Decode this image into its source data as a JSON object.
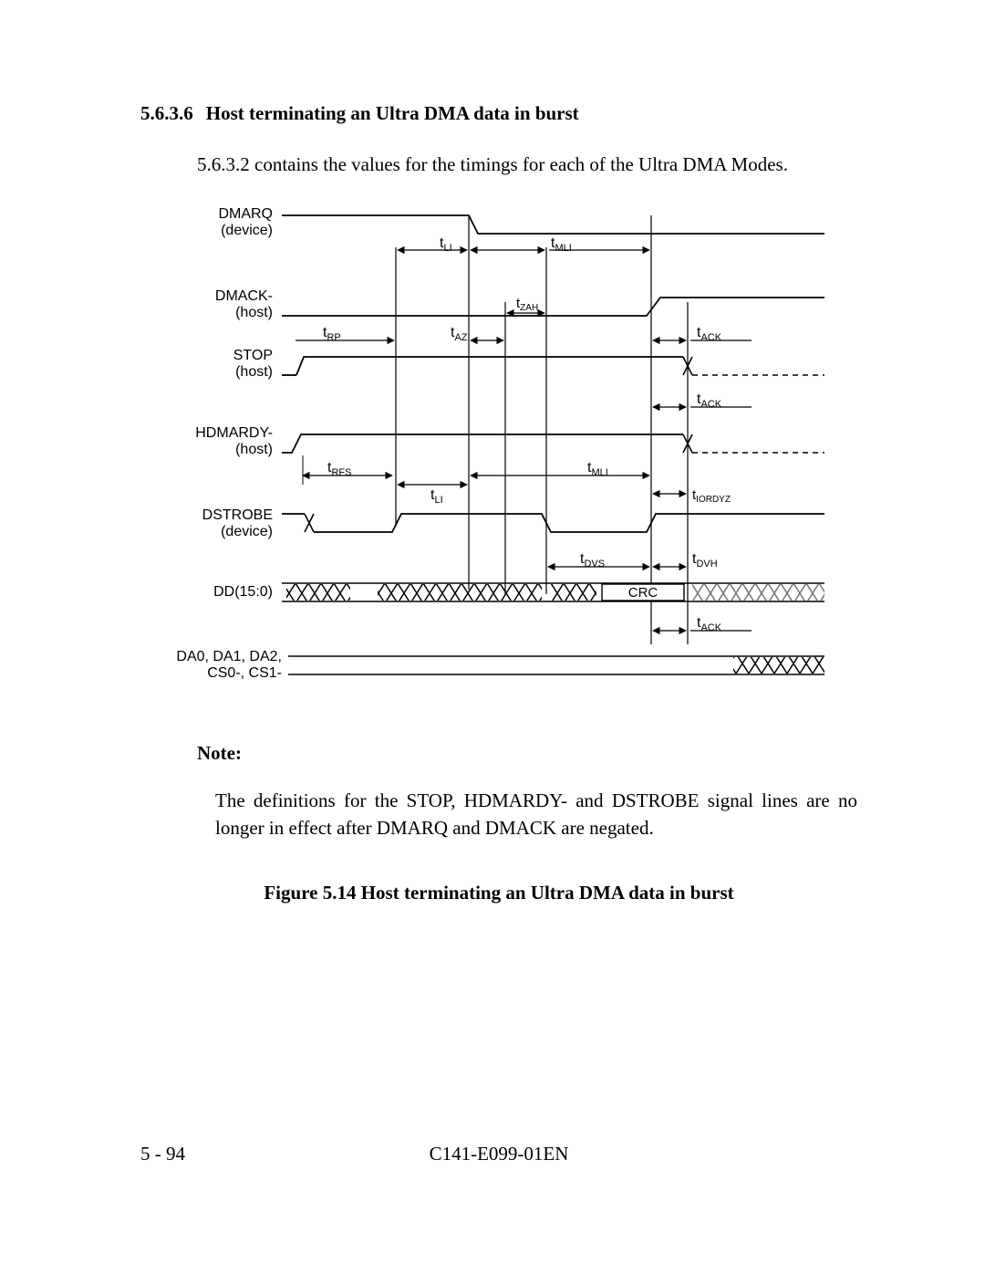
{
  "section": {
    "number": "5.6.3.6",
    "title": "Host terminating an Ultra DMA data in burst"
  },
  "intro": "5.6.3.2 contains the values for the timings for each of the Ultra DMA Modes.",
  "note": {
    "label": "Note:",
    "body": "The definitions for the STOP, HDMARDY- and DSTROBE signal lines are no longer in effect after DMARQ and DMACK are negated."
  },
  "figure": {
    "caption": "Figure 5.14  Host terminating an Ultra DMA data in burst"
  },
  "diagram": {
    "signals": {
      "dmarq": {
        "line1": "DMARQ",
        "line2": "(device)"
      },
      "dmack": {
        "line1": "DMACK-",
        "line2": "(host)"
      },
      "stop": {
        "line1": "STOP",
        "line2": "(host)"
      },
      "hdmardy": {
        "line1": "HDMARDY-",
        "line2": "(host)"
      },
      "dstrobe": {
        "line1": "DSTROBE",
        "line2": "(device)"
      },
      "dd": {
        "line1": "DD(15:0)"
      },
      "da": {
        "line1": "DA0, DA1, DA2,",
        "line2": "CS0-, CS1-"
      }
    },
    "timings": {
      "t_li_1": "t",
      "t_li_1s": "LI",
      "t_mli_1": "t",
      "t_mli_1s": "MLI",
      "t_zah": "t",
      "t_zah_s": "ZAH",
      "t_rp": "t",
      "t_rp_s": "RP",
      "t_az": "t",
      "t_az_s": "AZ",
      "t_ack_1": "t",
      "t_ack_1s": "ACK",
      "t_ack_2": "t",
      "t_ack_2s": "ACK",
      "t_rfs": "t",
      "t_rfs_s": "RFS",
      "t_li_2": "t",
      "t_li_2s": "LI",
      "t_mli_2": "t",
      "t_mli_2s": "MLI",
      "t_iordyz": "t",
      "t_iordyz_s": "IORDYZ",
      "t_dvs": "t",
      "t_dvs_s": "DVS",
      "t_dvh": "t",
      "t_dvh_s": "DVH",
      "t_ack_3": "t",
      "t_ack_3s": "ACK",
      "crc": "CRC"
    }
  },
  "footer": {
    "page": "5 - 94",
    "doc": "C141-E099-01EN"
  }
}
